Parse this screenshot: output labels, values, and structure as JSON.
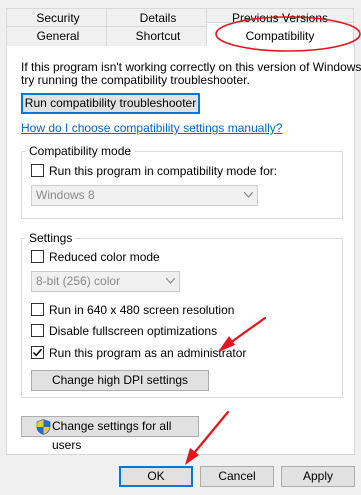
{
  "tabs_row1": [
    {
      "label": "Security"
    },
    {
      "label": "Details"
    },
    {
      "label": "Previous Versions"
    }
  ],
  "tabs_row2": [
    {
      "label": "General"
    },
    {
      "label": "Shortcut"
    },
    {
      "label": "Compatibility"
    }
  ],
  "intro": {
    "line1": "If this program isn't working correctly on this version of Windows,",
    "line2": "try running the compatibility troubleshooter."
  },
  "troubleshooter_button": "Run compatibility troubleshooter",
  "help_link": "How do I choose compatibility settings manually?",
  "compat_mode": {
    "legend": "Compatibility mode",
    "checkbox_label": "Run this program in compatibility mode for:",
    "checked": false,
    "select_value": "Windows 8"
  },
  "settings": {
    "legend": "Settings",
    "reduced_color": {
      "label": "Reduced color mode",
      "checked": false
    },
    "color_select_value": "8-bit (256) color",
    "res_640": {
      "label": "Run in 640 x 480 screen resolution",
      "checked": false
    },
    "disable_fullscreen": {
      "label": "Disable fullscreen optimizations",
      "checked": false
    },
    "run_as_admin": {
      "label": "Run this program as an administrator",
      "checked": true
    },
    "dpi_button": "Change high DPI settings"
  },
  "all_users_button": "Change settings for all users",
  "footer": {
    "ok": "OK",
    "cancel": "Cancel",
    "apply": "Apply"
  },
  "colors": {
    "annotation_red": "#e8141c",
    "link_blue": "#0066cc",
    "focus_blue": "#0078d7"
  }
}
